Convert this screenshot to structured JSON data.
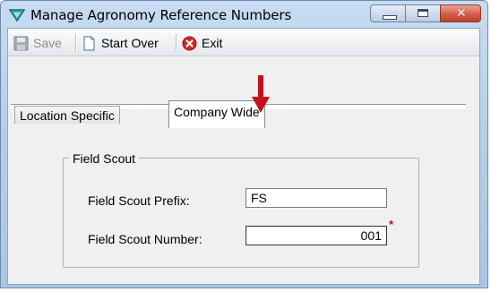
{
  "window": {
    "title": "Manage Agronomy Reference Numbers",
    "minimize_symbol": "▭",
    "maximize_symbol": "□",
    "close_symbol": "✕"
  },
  "toolbar": {
    "save_label": "Save",
    "start_over_label": "Start Over",
    "exit_label": "Exit"
  },
  "tabs": [
    {
      "label": "Location Specific",
      "active": false
    },
    {
      "label": "Company Wide",
      "active": true
    }
  ],
  "field_scout": {
    "group_label": "Field Scout",
    "prefix_label": "Field Scout Prefix:",
    "prefix_value": "FS",
    "number_label": "Field Scout Number:",
    "number_value": "001",
    "required_mark": "*"
  },
  "colors": {
    "accent_arrow": "#c8101a",
    "required": "#e00000"
  },
  "icons": [
    "app-funnel-icon",
    "save-disk-icon",
    "page-icon",
    "exit-x-icon",
    "pointer-arrow-icon"
  ]
}
